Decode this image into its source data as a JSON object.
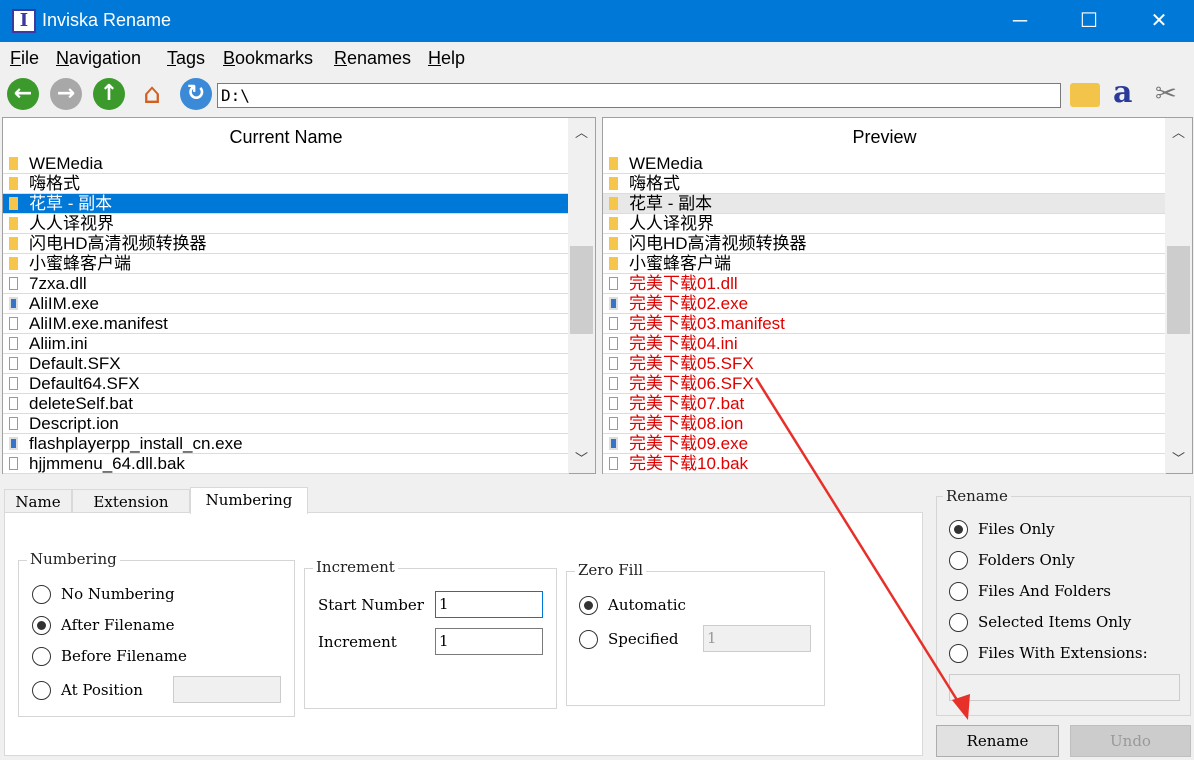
{
  "window": {
    "title": "Inviska Rename",
    "app_icon": "I",
    "minimize": "─",
    "maximize": "☐",
    "close": "✕"
  },
  "menu": [
    "File",
    "Navigation",
    "Tags",
    "Bookmarks",
    "Renames",
    "Help"
  ],
  "toolbar": {
    "path": "D:\\"
  },
  "current": {
    "header": "Current Name",
    "items": [
      {
        "name": "WEMedia",
        "type": "folder"
      },
      {
        "name": "嗨格式",
        "type": "folder"
      },
      {
        "name": "花草 - 副本",
        "type": "folder",
        "selected": true
      },
      {
        "name": "人人译视界",
        "type": "folder"
      },
      {
        "name": "闪电HD高清视频转换器",
        "type": "folder"
      },
      {
        "name": "小蜜蜂客户端",
        "type": "folder"
      },
      {
        "name": "7zxa.dll",
        "type": "file"
      },
      {
        "name": "AliIM.exe",
        "type": "exe"
      },
      {
        "name": "AliIM.exe.manifest",
        "type": "file"
      },
      {
        "name": "Aliim.ini",
        "type": "file"
      },
      {
        "name": "Default.SFX",
        "type": "file"
      },
      {
        "name": "Default64.SFX",
        "type": "file"
      },
      {
        "name": "deleteSelf.bat",
        "type": "file"
      },
      {
        "name": "Descript.ion",
        "type": "file"
      },
      {
        "name": "flashplayerpp_install_cn.exe",
        "type": "exe"
      },
      {
        "name": "hjjmmenu_64.dll.bak",
        "type": "file"
      }
    ]
  },
  "preview": {
    "header": "Preview",
    "items": [
      {
        "name": "WEMedia",
        "type": "folder"
      },
      {
        "name": "嗨格式",
        "type": "folder"
      },
      {
        "name": "花草 - 副本",
        "type": "folder",
        "selected": true
      },
      {
        "name": "人人译视界",
        "type": "folder"
      },
      {
        "name": "闪电HD高清视频转换器",
        "type": "folder"
      },
      {
        "name": "小蜜蜂客户端",
        "type": "folder"
      },
      {
        "name": "完美下载01.dll",
        "type": "file",
        "changed": true
      },
      {
        "name": "完美下载02.exe",
        "type": "exe",
        "changed": true
      },
      {
        "name": "完美下载03.manifest",
        "type": "file",
        "changed": true
      },
      {
        "name": "完美下载04.ini",
        "type": "file",
        "changed": true
      },
      {
        "name": "完美下载05.SFX",
        "type": "file",
        "changed": true
      },
      {
        "name": "完美下载06.SFX",
        "type": "file",
        "changed": true
      },
      {
        "name": "完美下载07.bat",
        "type": "file",
        "changed": true
      },
      {
        "name": "完美下载08.ion",
        "type": "file",
        "changed": true
      },
      {
        "name": "完美下载09.exe",
        "type": "exe",
        "changed": true
      },
      {
        "name": "完美下载10.bak",
        "type": "file",
        "changed": true
      }
    ]
  },
  "tabs": [
    "Name",
    "Extension",
    "Numbering"
  ],
  "numbering": {
    "legend": "Numbering",
    "options": [
      "No Numbering",
      "After Filename",
      "Before Filename",
      "At Position"
    ],
    "selected": 1,
    "position_value": ""
  },
  "increment": {
    "legend": "Increment",
    "start_label": "Start Number",
    "start_value": "1",
    "inc_label": "Increment",
    "inc_value": "1"
  },
  "zerofill": {
    "legend": "Zero Fill",
    "options": [
      "Automatic",
      "Specified"
    ],
    "selected": 0,
    "specified_value": "1"
  },
  "rename_group": {
    "legend": "Rename",
    "options": [
      "Files Only",
      "Folders Only",
      "Files And Folders",
      "Selected Items Only",
      "Files With Extensions:"
    ],
    "selected": 0,
    "extensions_value": ""
  },
  "buttons": {
    "rename": "Rename",
    "undo": "Undo"
  }
}
